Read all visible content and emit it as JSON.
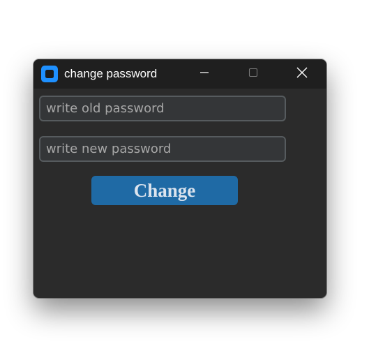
{
  "window": {
    "title": "change password",
    "icon": "app-icon",
    "controls": {
      "minimize": "minimize-icon",
      "maximize": "maximize-icon",
      "close": "close-icon"
    }
  },
  "form": {
    "old_password": {
      "placeholder": "write old password",
      "value": ""
    },
    "new_password": {
      "placeholder": "write new password",
      "value": ""
    },
    "submit_label": "Change"
  },
  "colors": {
    "window_bg": "#2b2b2b",
    "titlebar_bg": "#1f1f1f",
    "input_bg": "#343638",
    "input_border": "#565b5e",
    "button_bg": "#1f6aa5",
    "button_text": "#dce4ee",
    "icon_accent": "#1e90ff"
  }
}
